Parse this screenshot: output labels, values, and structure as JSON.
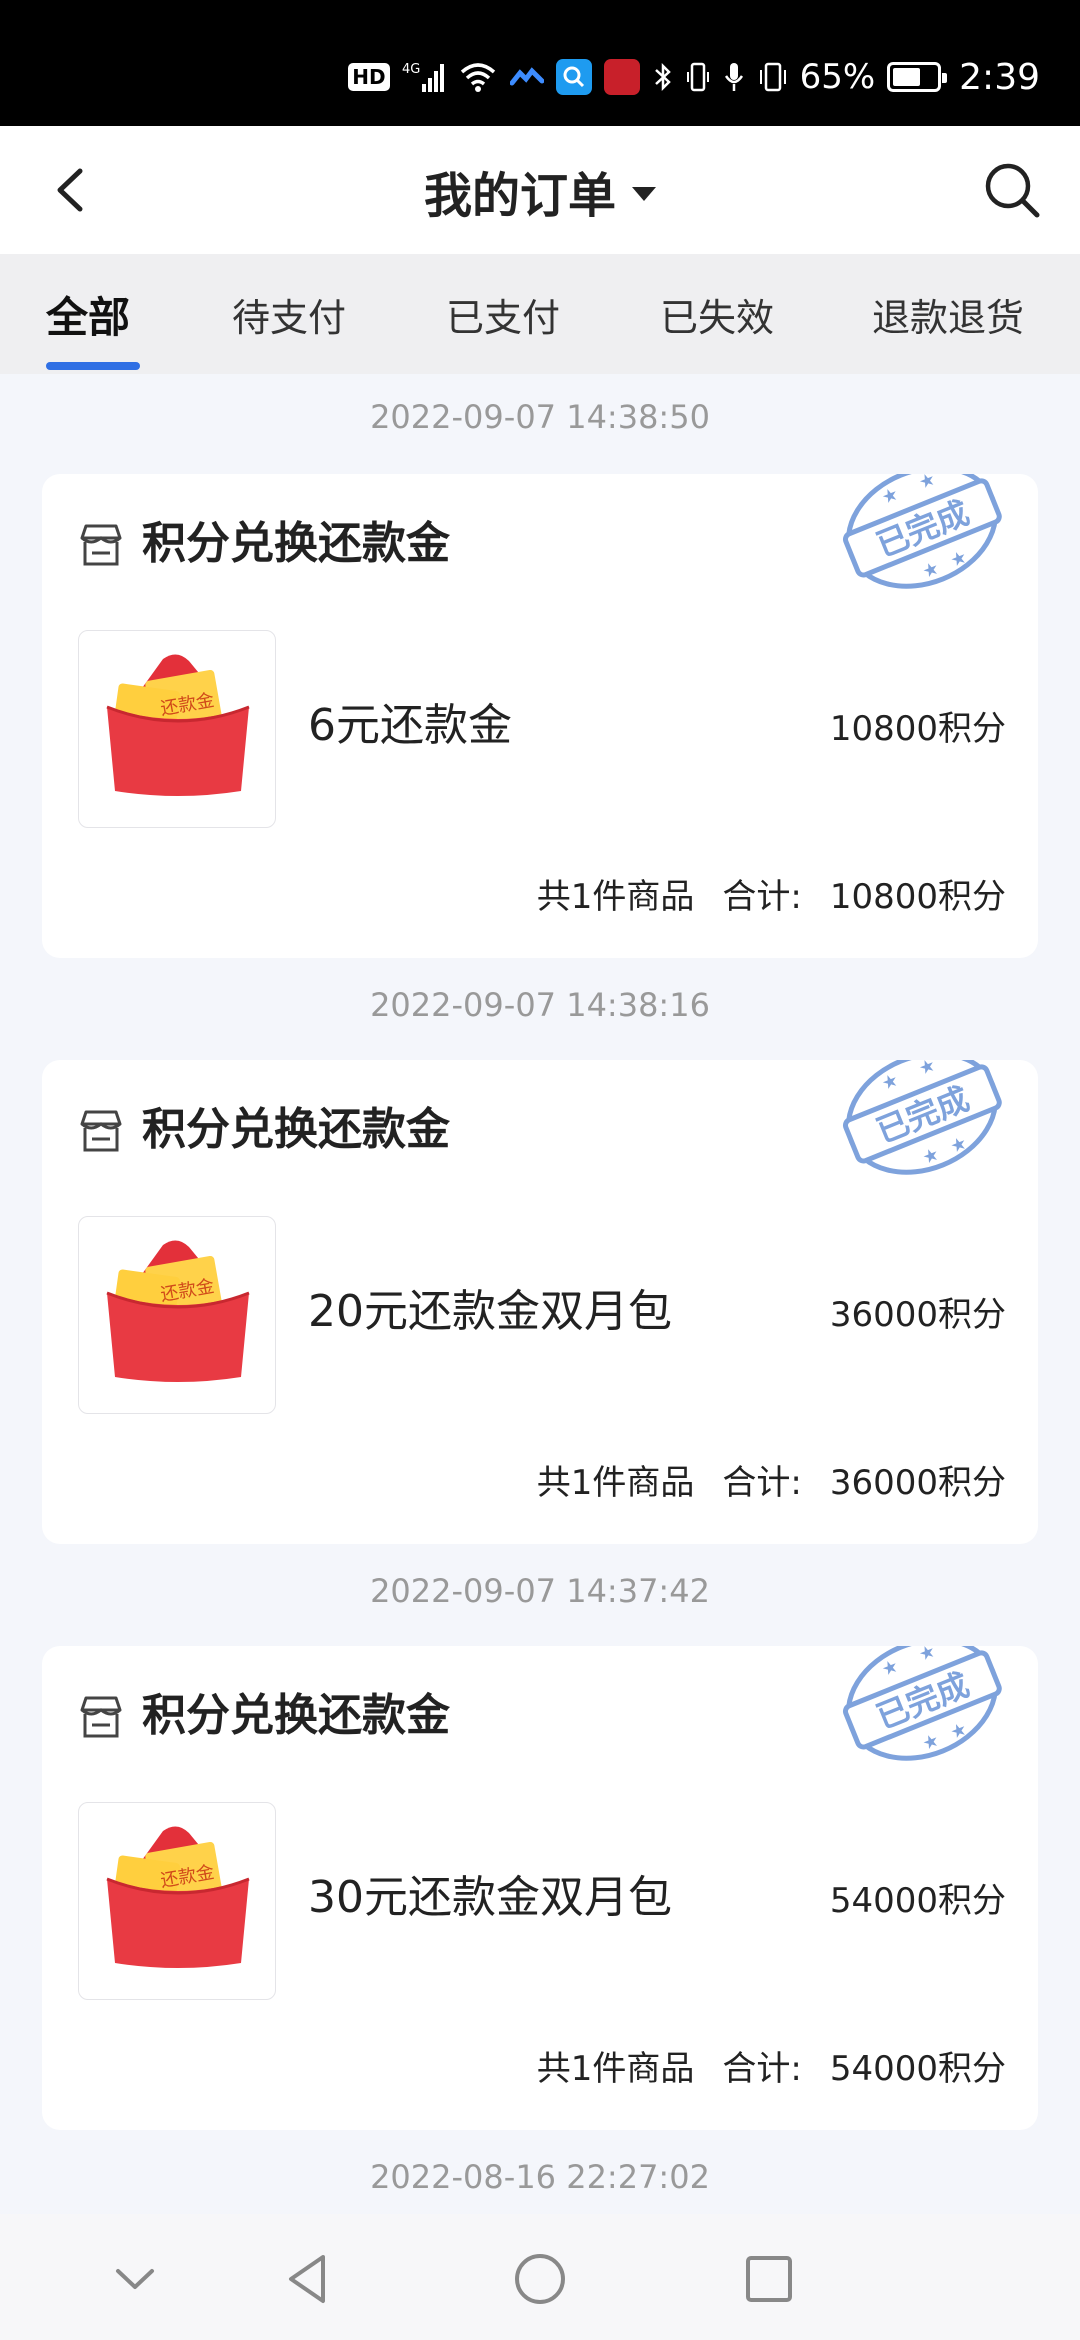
{
  "status_bar": {
    "hd_label": "HD",
    "network_label": "4G",
    "battery_percent": 65,
    "battery_text": "65%",
    "time": "2:39",
    "icons": [
      "hd-icon",
      "signal-icon",
      "wifi-icon",
      "app-notification-icon",
      "search-app-icon",
      "news-app-icon",
      "bluetooth-icon",
      "microphone-icon",
      "vibrate-icon",
      "battery-icon"
    ]
  },
  "header": {
    "title": "我的订单",
    "back_icon": "chevron-left-icon",
    "dropdown_icon": "caret-down-icon",
    "search_icon": "search-icon"
  },
  "tabs": [
    {
      "label": "全部",
      "active": true
    },
    {
      "label": "待支付",
      "active": false
    },
    {
      "label": "已支付",
      "active": false
    },
    {
      "label": "已失效",
      "active": false
    },
    {
      "label": "退款退货",
      "active": false
    }
  ],
  "orders": [
    {
      "datetime": "2022-09-07 14:38:50",
      "store": "积分兑换还款金",
      "status_stamp": "已完成",
      "thumb_label": "还款金",
      "item_name": "6元还款金",
      "item_price": "10800积分",
      "count_text": "共1件商品",
      "total_label": "合计:",
      "total_value": "10800积分"
    },
    {
      "datetime": "2022-09-07 14:38:16",
      "store": "积分兑换还款金",
      "status_stamp": "已完成",
      "thumb_label": "还款金",
      "item_name": "20元还款金双月包",
      "item_price": "36000积分",
      "count_text": "共1件商品",
      "total_label": "合计:",
      "total_value": "36000积分"
    },
    {
      "datetime": "2022-09-07 14:37:42",
      "store": "积分兑换还款金",
      "status_stamp": "已完成",
      "thumb_label": "还款金",
      "item_name": "30元还款金双月包",
      "item_price": "54000积分",
      "count_text": "共1件商品",
      "total_label": "合计:",
      "total_value": "54000积分"
    }
  ],
  "trailing_date": "2022-08-16 22:27:02",
  "system_nav": {
    "icons": [
      "chevron-down-icon",
      "back-triangle-icon",
      "home-circle-icon",
      "recents-square-icon"
    ]
  },
  "colors": {
    "accent": "#2f6fe4",
    "stamp": "#6f9ad8",
    "envelope_red": "#e5323c",
    "ticket_yellow": "#ffd24a"
  }
}
